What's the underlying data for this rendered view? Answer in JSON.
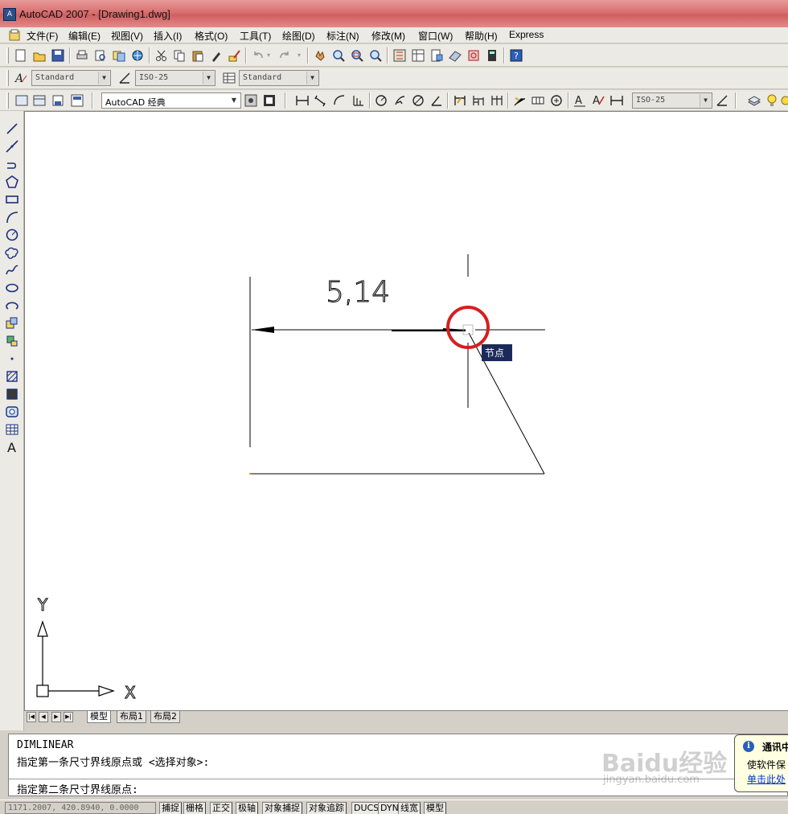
{
  "window": {
    "title": "AutoCAD 2007 - [Drawing1.dwg]"
  },
  "menu": [
    "文件(F)",
    "编辑(E)",
    "视图(V)",
    "插入(I)",
    "格式(O)",
    "工具(T)",
    "绘图(D)",
    "标注(N)",
    "修改(M)",
    "窗口(W)",
    "帮助(H)",
    "Express"
  ],
  "styles_toolbar": {
    "text_style": "Standard",
    "dim_style": "ISO-25",
    "table_style": "Standard"
  },
  "workspace_toolbar": {
    "workspace": "AutoCAD 经典",
    "dim_style_combo": "ISO-25"
  },
  "drawing": {
    "dimension_text": "5,14",
    "snap_tooltip": "节点",
    "ucs_y_label": "Y",
    "ucs_x_label": "X"
  },
  "layout_tabs": [
    {
      "label": "模型",
      "active": true
    },
    {
      "label": "布局1",
      "active": false
    },
    {
      "label": "布局2",
      "active": false
    }
  ],
  "command_line": {
    "history": [
      "DIMLINEAR",
      "指定第一条尺寸界线原点或 <选择对象>:"
    ],
    "prompt": "指定第二条尺寸界线原点:"
  },
  "notification": {
    "title": "通讯中",
    "body": "使软件保",
    "link": "单击此处"
  },
  "status_bar": {
    "coordinates": "1171.2007, 420.8940, 0.0000",
    "toggles": [
      "捕捉",
      "栅格",
      "正交",
      "极轴",
      "对象捕捉",
      "对象追踪",
      "DUCS",
      "DYN",
      "线宽",
      "模型"
    ]
  },
  "watermark": {
    "text": "Baidu经验",
    "url": "jingyan.baidu.com"
  },
  "colors": {
    "titlebar": "#d96f6f",
    "snap_marker": "#d42020",
    "tooltip_bg": "#1c2a5a",
    "canvas": "#ffffff"
  }
}
